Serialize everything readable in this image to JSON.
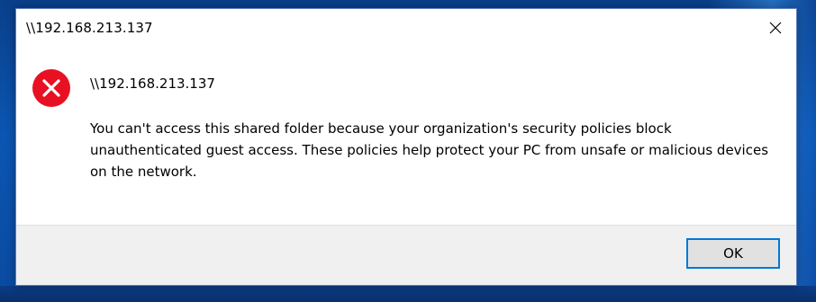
{
  "dialog": {
    "title": "\\\\192.168.213.137",
    "main_instruction": "\\\\192.168.213.137",
    "message": "You can't access this shared folder because your organization's security policies block unauthenticated guest access. These policies help protect your PC from unsafe or malicious devices on the network.",
    "ok_label": "OK",
    "close_icon": "close-icon",
    "status_icon": "error-icon"
  },
  "colors": {
    "error_red": "#e81123",
    "focus_blue": "#0078d7",
    "footer_bg": "#f0f0f0"
  }
}
